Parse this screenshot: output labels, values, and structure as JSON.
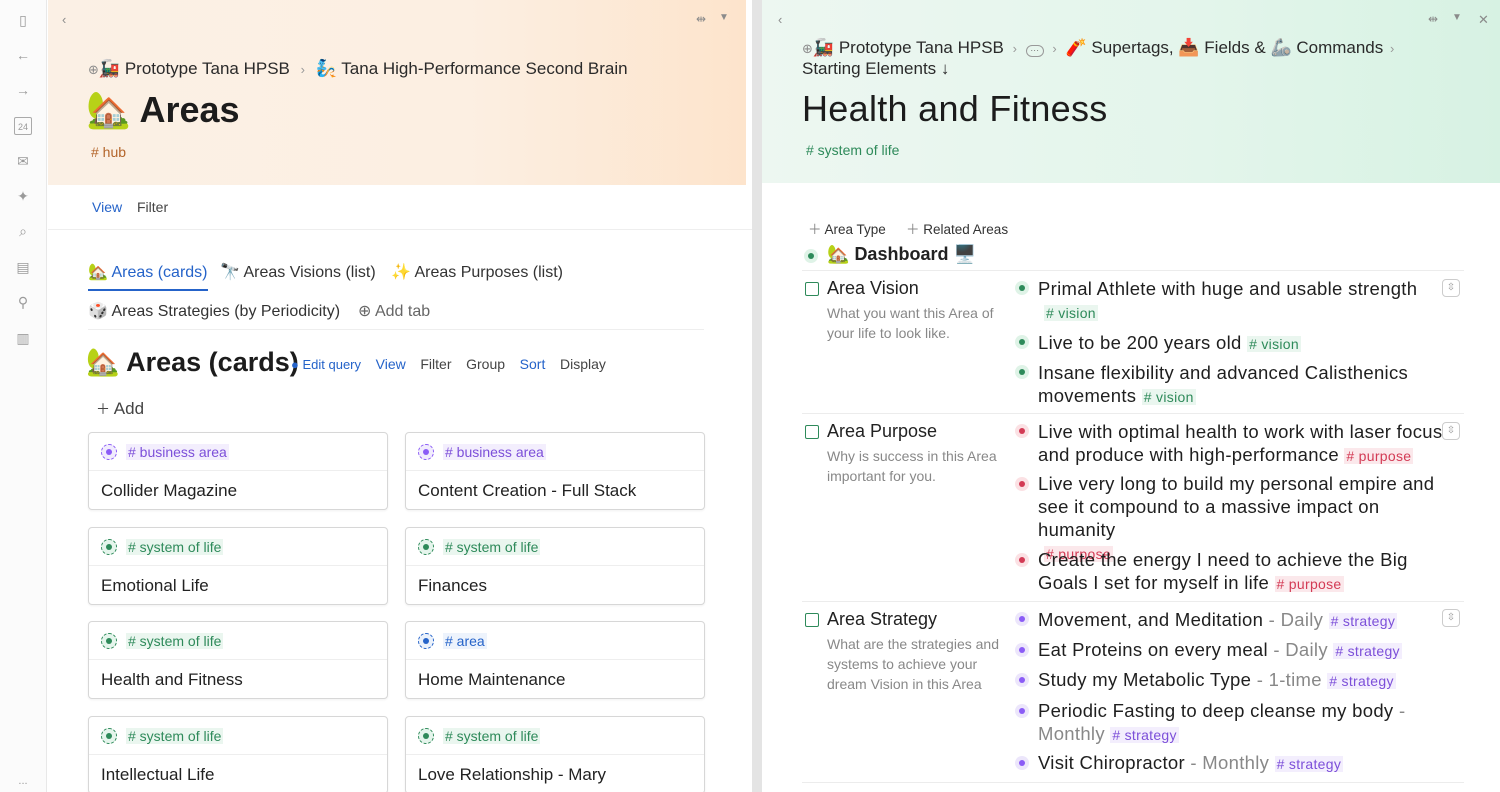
{
  "rail": {
    "icons": [
      "sidebar-toggle-icon",
      "back-arrow-icon",
      "forward-arrow-icon",
      "calendar-icon",
      "inbox-icon",
      "ai-sparkle-icon",
      "search-icon",
      "supertags-icon",
      "pin-icon",
      "dashboard-icon"
    ],
    "calendar_num": "24",
    "more": "..."
  },
  "left": {
    "breadcrumb": {
      "ws": "Prototype Tana HPSB",
      "page": "Tana High-Performance Second Brain",
      "ws_emoji": "🚂",
      "page_emoji": "🧞"
    },
    "title": "Areas",
    "title_emoji": "🏡",
    "tag": "# hub",
    "view_label": "View",
    "filter_label": "Filter",
    "tabs": [
      {
        "emoji": "🏡",
        "label": "Areas (cards)"
      },
      {
        "emoji": "🔭",
        "label": "Areas Visions (list)"
      },
      {
        "emoji": "✨",
        "label": "Areas Purposes (list)"
      },
      {
        "emoji": "🎲",
        "label": "Areas Strategies (by Periodicity)"
      }
    ],
    "add_tab": "Add tab",
    "search_title": "Areas (cards)",
    "search_emoji": "🏡",
    "toolbar": {
      "edit_query": "Edit query",
      "view": "View",
      "filter": "Filter",
      "group": "Group",
      "sort": "Sort",
      "display": "Display"
    },
    "add": "Add",
    "cards": [
      {
        "tag": "# business area",
        "name": "Collider Magazine",
        "kind": "p"
      },
      {
        "tag": "# business area",
        "name": "Content Creation - Full Stack",
        "kind": "p"
      },
      {
        "tag": "# system of life",
        "name": "Emotional Life",
        "kind": "g"
      },
      {
        "tag": "# system of life",
        "name": "Finances",
        "kind": "g"
      },
      {
        "tag": "# system of life",
        "name": "Health and Fitness",
        "kind": "g"
      },
      {
        "tag": "# area",
        "name": "Home Maintenance",
        "kind": "b"
      },
      {
        "tag": "# system of life",
        "name": "Intellectual Life",
        "kind": "g"
      },
      {
        "tag": "# system of life",
        "name": "Love Relationship - Mary",
        "kind": "g"
      }
    ]
  },
  "right": {
    "breadcrumb": {
      "ws": "Prototype Tana HPSB",
      "seg2": "Supertags,",
      "seg3": "Fields &",
      "seg4": "Commands",
      "seg5": "Starting Elements ↓",
      "ws_emoji": "🚂",
      "seg2_emoji": "🧨",
      "seg3_emoji": "📥",
      "seg4_emoji": "🦾"
    },
    "title": "Health and Fitness",
    "tag": "# system of life",
    "area_type": "Area Type",
    "related": "Related Areas",
    "dashboard": "Dashboard",
    "dashboard_emoji": "🏡",
    "dashboard_emoji2": "🖥️",
    "fields": [
      {
        "name": "Area Vision",
        "desc": "What you want this Area of your life to look like."
      },
      {
        "name": "Area Purpose",
        "desc": "Why is success in this Area important for you."
      },
      {
        "name": "Area Strategy",
        "desc": "What are the strategies and systems to achieve your dream Vision in this Area"
      }
    ],
    "visions": [
      {
        "text": "Primal Athlete with huge and usable strength",
        "tag": "# vision"
      },
      {
        "text": "Live to be 200 years old",
        "tag": "# vision"
      },
      {
        "text": "Insane flexibility and advanced Calisthenics movements",
        "tag": "# vision"
      }
    ],
    "purposes": [
      {
        "text": "Live with optimal health to work with laser focus and produce with high-performance",
        "tag": "# purpose"
      },
      {
        "text": "Live very long to build my personal empire and see it compound to a massive impact on humanity",
        "tag": "# purpose"
      },
      {
        "text": "Create the energy I need to achieve the Big Goals I set for myself in life",
        "tag": "# purpose"
      }
    ],
    "strategies": [
      {
        "text": "Movement, and Meditation",
        "period": "- Daily",
        "tag": "# strategy"
      },
      {
        "text": "Eat Proteins on every meal",
        "period": "- Daily",
        "tag": "# strategy"
      },
      {
        "text": "Study my Metabolic Type",
        "period": "- 1-time",
        "tag": "# strategy"
      },
      {
        "text": "Periodic Fasting to deep cleanse my body",
        "period": "- Monthly",
        "tag": "# strategy"
      },
      {
        "text": "Visit Chiropractor",
        "period": "- Monthly",
        "tag": "# strategy"
      }
    ]
  },
  "colors": {
    "link": "#2563c9",
    "system": "#2e8a5a",
    "purpose": "#d33b55",
    "strategy": "#7c4fd9",
    "hub": "#b3652a"
  }
}
